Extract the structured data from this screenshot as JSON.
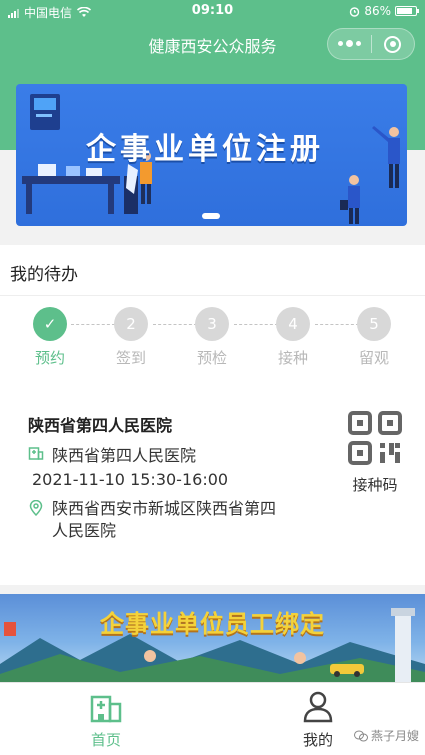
{
  "status_bar": {
    "carrier": "中国电信",
    "time": "09:10",
    "battery": "86%",
    "battery_level": 0.86
  },
  "nav": {
    "title": "健康西安公众服务"
  },
  "banner": {
    "text": "企事业单位注册"
  },
  "todo": {
    "title": "我的待办",
    "steps": [
      {
        "num": "✓",
        "label": "预约"
      },
      {
        "num": "2",
        "label": "签到"
      },
      {
        "num": "3",
        "label": "预检"
      },
      {
        "num": "4",
        "label": "接种"
      },
      {
        "num": "5",
        "label": "留观"
      }
    ],
    "hospital_title": "陕西省第四人民医院",
    "hospital": "陕西省第四人民医院",
    "datetime": "2021-11-10 15:30-16:00",
    "address": "陕西省西安市新城区陕西省第四人民医院",
    "qr_label": "接种码"
  },
  "banner2": {
    "text": "企事业单位员工绑定"
  },
  "tabs": {
    "home": "首页",
    "me": "我的"
  },
  "watermark": "燕子月嫂",
  "colors": {
    "accent": "#5dbf8b",
    "banner": "#3a7de8"
  }
}
